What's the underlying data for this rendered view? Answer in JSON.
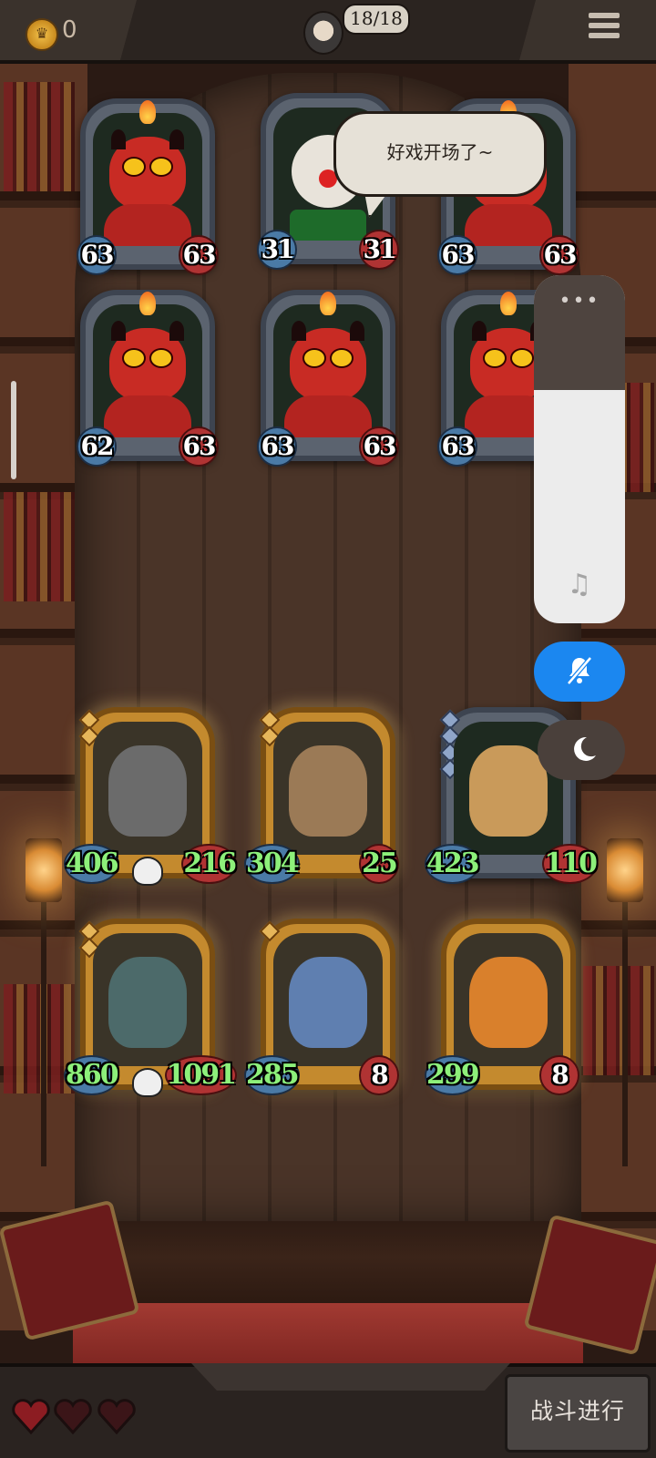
{
  "topbar": {
    "coin_count": "0",
    "energy": "18/18",
    "menu_icon": "hamburger-menu-icon"
  },
  "enemy_board": {
    "units": [
      {
        "slot": 1,
        "kind": "red-devil",
        "atk": "63",
        "hp": "63"
      },
      {
        "slot": 2,
        "kind": "clown-drummer",
        "atk": "31",
        "hp": "31"
      },
      {
        "slot": 3,
        "kind": "red-devil",
        "atk": "63",
        "hp": "63"
      },
      {
        "slot": 4,
        "kind": "red-devil",
        "atk": "62",
        "hp": "63"
      },
      {
        "slot": 5,
        "kind": "red-devil",
        "atk": "63",
        "hp": "63"
      },
      {
        "slot": 6,
        "kind": "red-devil",
        "atk": "63",
        "hp": ""
      }
    ]
  },
  "speech_bubble": {
    "text": "好戏开场了~"
  },
  "player_board": {
    "units": [
      {
        "slot": 1,
        "kind": "robot-skull",
        "atk": "406",
        "hp": "216",
        "skull": true
      },
      {
        "slot": 2,
        "kind": "treant",
        "atk": "304",
        "hp": "25"
      },
      {
        "slot": 3,
        "kind": "bearded-warrior",
        "atk": "423",
        "hp": "110"
      },
      {
        "slot": 4,
        "kind": "iron-golem",
        "atk": "860",
        "hp": "1091",
        "skull": true
      },
      {
        "slot": 5,
        "kind": "elf-sorceress",
        "atk": "285",
        "hp": "8"
      },
      {
        "slot": 6,
        "kind": "pumpkin-head",
        "atk": "299",
        "hp": "8"
      }
    ]
  },
  "system_panel": {
    "dots": "•••",
    "music_icon": "music-note-icon",
    "mute_icon": "bell-off-icon",
    "night_icon": "moon-icon"
  },
  "bottom": {
    "lives": [
      "heart-icon",
      "heart-icon",
      "heart-icon"
    ],
    "fight_button": "战斗进行"
  },
  "colors": {
    "mute_button": "#1b87f0",
    "buffed_stat": "#8df07a",
    "gold_frame": "#c48a2e",
    "silver_frame": "#5b636f"
  }
}
